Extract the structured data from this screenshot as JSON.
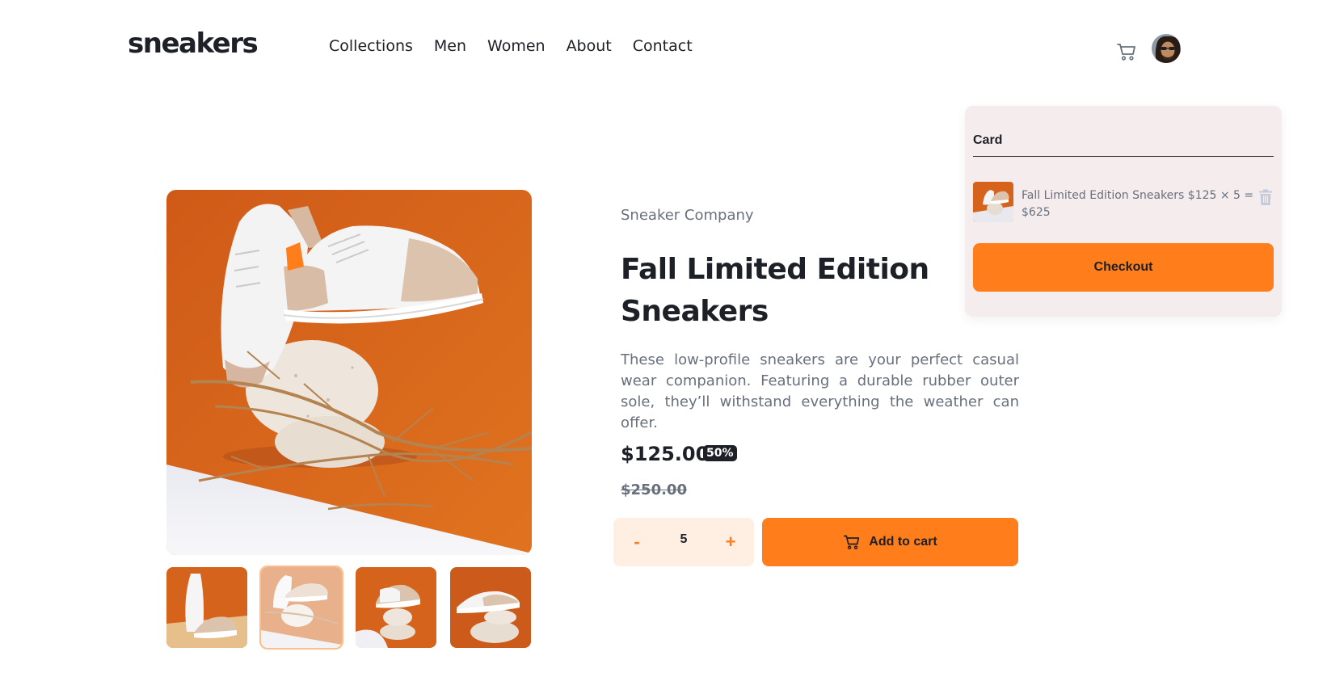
{
  "header": {
    "logo": "sneakers",
    "nav": [
      "Collections",
      "Men",
      "Women",
      "About",
      "Contact"
    ]
  },
  "cart": {
    "title": "Card",
    "item_text": "Fall Limited Edition Sneakers $125 × 5 = $625",
    "checkout_label": "Checkout"
  },
  "product": {
    "company": "Sneaker Company",
    "title": "Fall Limited Edition Sneakers",
    "description": "These low-profile sneakers are your perfect casual wear companion. Featuring a durable rubber outer sole, they’ll withstand everything the weather can offer.",
    "price": "$125.00",
    "discount": "50%",
    "old_price": "$250.00",
    "quantity": "5",
    "minus_label": "-",
    "plus_label": "+",
    "add_to_cart_label": "Add to cart"
  },
  "colors": {
    "accent": "#ff7e1b",
    "accent_pale": "#ffeee2",
    "text_dark": "#1d2026",
    "text_gray": "#68707d",
    "cart_panel_bg": "#f5eced"
  },
  "icons": [
    "cart-icon",
    "avatar",
    "delete-icon",
    "product-image",
    "thumbnail"
  ]
}
